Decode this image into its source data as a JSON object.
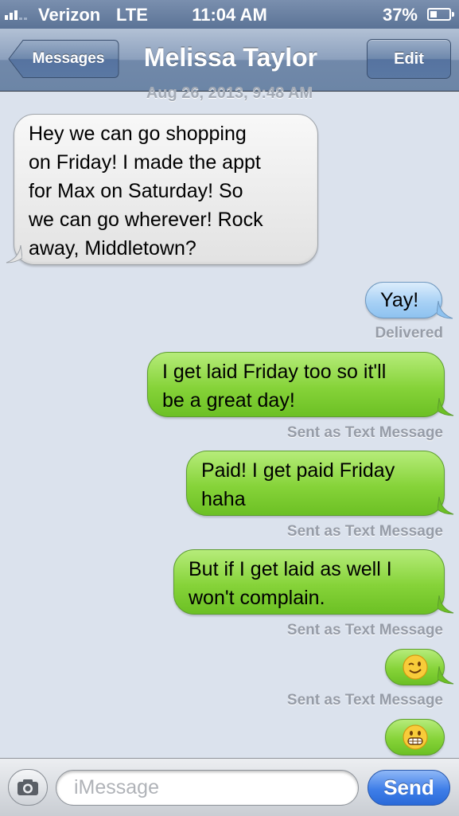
{
  "status_bar": {
    "carrier": "Verizon",
    "network": "LTE",
    "time": "11:04 AM",
    "battery": "37%",
    "battery_level": 0.37,
    "signal_bars": 3,
    "signal_icon": "signal-bars-icon",
    "battery_icon": "battery-icon"
  },
  "nav": {
    "back_label": "Messages",
    "title": "Melissa Taylor",
    "edit_label": "Edit"
  },
  "conversation": {
    "date_stamp": "Aug 26, 2013, 9:48 AM",
    "messages": [
      {
        "from": "contact",
        "style": "gray",
        "lines": [
          "Hey we can go shopping",
          "on Friday! I made the appt",
          "for Max on Saturday! So",
          "we can go wherever! Rock",
          "away, Middletown?"
        ]
      },
      {
        "from": "me",
        "style": "blue",
        "lines": [
          "Yay!"
        ],
        "status": "Delivered"
      },
      {
        "from": "me",
        "style": "green",
        "lines": [
          "I get laid Friday too so it'll",
          "be a great day!"
        ],
        "status": "Sent as Text Message"
      },
      {
        "from": "me",
        "style": "green",
        "lines": [
          "Paid! I get paid Friday",
          "haha"
        ],
        "status": "Sent as Text Message"
      },
      {
        "from": "me",
        "style": "green",
        "lines": [
          "But if I get laid as well I",
          "won't complain."
        ],
        "status": "Sent as Text Message"
      },
      {
        "from": "me",
        "style": "green",
        "emoji": "winking-face-emoji",
        "status": "Sent as Text Message"
      },
      {
        "from": "me",
        "style": "green",
        "emoji": "grimacing-face-emoji"
      }
    ]
  },
  "input_bar": {
    "camera_icon": "camera-icon",
    "placeholder": "iMessage",
    "send_label": "Send"
  },
  "colors": {
    "background": "#dbe2ed",
    "navbar": "#6c85a6",
    "green_bubble": "#86d339",
    "blue_bubble": "#a8d1f5",
    "gray_bubble": "#ececec",
    "send_button": "#3f7ee8"
  }
}
